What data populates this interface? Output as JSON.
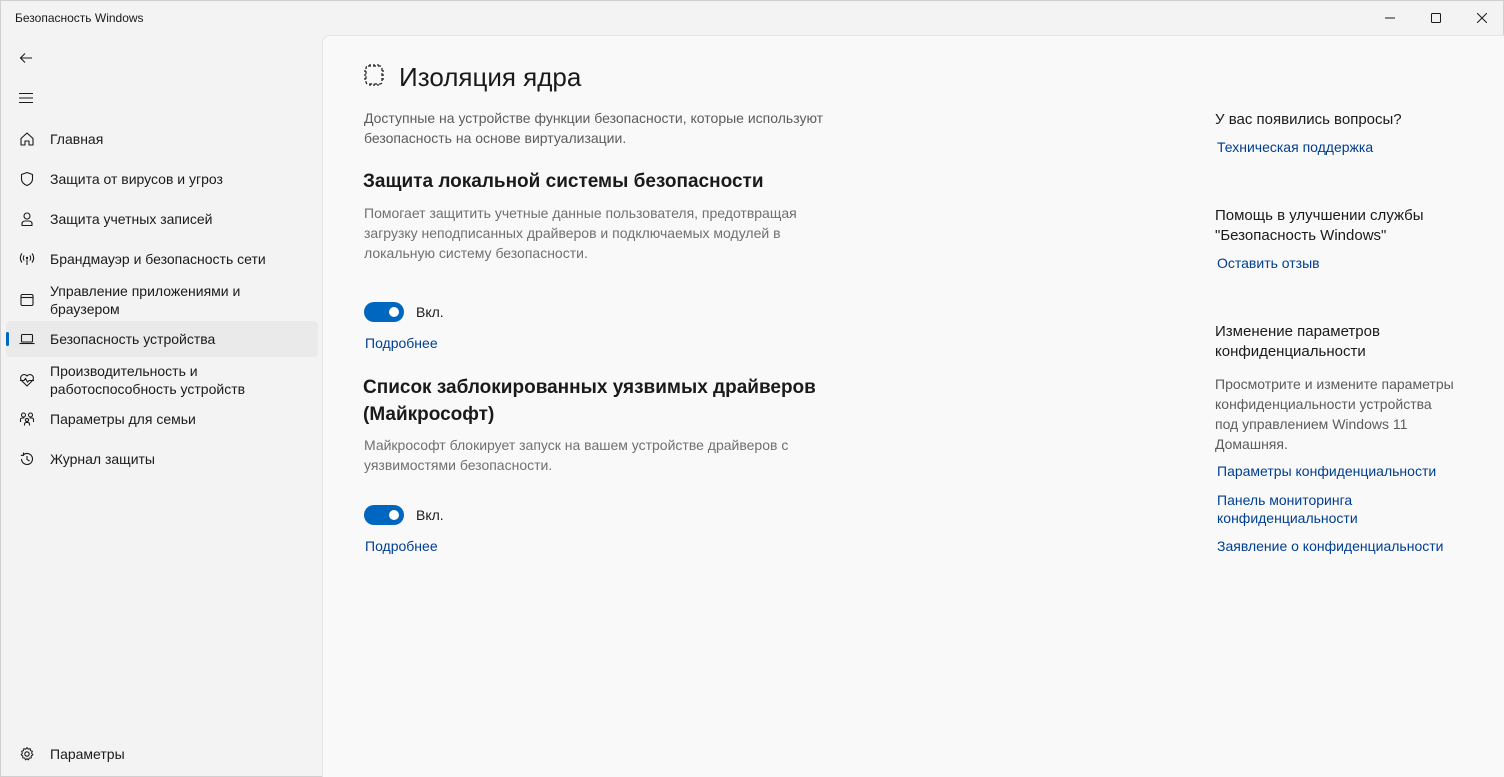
{
  "window": {
    "title": "Безопасность Windows"
  },
  "sidebar": {
    "items": [
      {
        "label": "Главная",
        "icon": "home-icon"
      },
      {
        "label": "Защита от вирусов и угроз",
        "icon": "shield-icon"
      },
      {
        "label": "Защита учетных записей",
        "icon": "person-icon"
      },
      {
        "label": "Брандмауэр и безопасность сети",
        "icon": "wifi-antenna-icon"
      },
      {
        "label": "Управление приложениями и браузером",
        "icon": "app-window-icon"
      },
      {
        "label": "Безопасность устройства",
        "icon": "laptop-icon",
        "active": true
      },
      {
        "label": "Производительность и работоспособность устройств",
        "icon": "heart-pulse-icon"
      },
      {
        "label": "Параметры для семьи",
        "icon": "family-icon"
      },
      {
        "label": "Журнал защиты",
        "icon": "history-icon"
      }
    ],
    "settings_label": "Параметры"
  },
  "main": {
    "title": "Изоляция ядра",
    "intro": "Доступные на устройстве функции безопасности, которые используют безопасность на основе виртуализации.",
    "sections": [
      {
        "title": "Защита локальной системы безопасности",
        "description": "Помогает защитить учетные данные пользователя, предотвращая загрузку неподписанных драйверов и подключаемых модулей в локальную систему безопасности.",
        "toggle_on": true,
        "toggle_label": "Вкл.",
        "link": "Подробнее"
      },
      {
        "title": "Список заблокированных уязвимых драйверов (Майкрософт)",
        "description": "Майкрософт блокирует запуск на вашем устройстве драйверов с уязвимостями безопасности.",
        "toggle_on": true,
        "toggle_label": "Вкл.",
        "link": "Подробнее"
      }
    ]
  },
  "right": {
    "questions_heading": "У вас появились вопросы?",
    "support_link": "Техническая поддержка",
    "improve_heading": "Помощь в улучшении службы \"Безопасность Windows\"",
    "feedback_link": "Оставить отзыв",
    "privacy_heading": "Изменение параметров конфиденциальности",
    "privacy_text": "Просмотрите и измените параметры конфиденциальности устройства под управлением Windows 11 Домашняя.",
    "privacy_settings_link": "Параметры конфиденциальности",
    "privacy_dashboard_link": "Панель мониторинга конфиденциальности",
    "privacy_statement_link": "Заявление о конфиденциальности"
  },
  "colors": {
    "accent": "#0067c0",
    "link": "#003e92",
    "background": "#f3f3f3",
    "content_background": "#f9f9f9"
  }
}
